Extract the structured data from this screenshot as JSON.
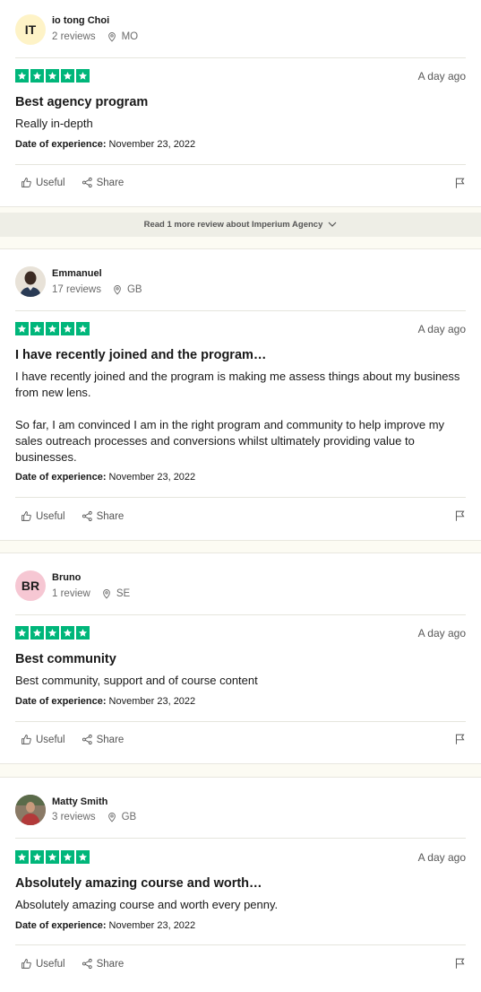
{
  "actions": {
    "useful": "Useful",
    "share": "Share"
  },
  "date_label": "Date of experience:",
  "read_more": "Read 1 more review about Imperium Agency",
  "colors": {
    "star_green": "#00b67a"
  },
  "reviews": [
    {
      "initials": "IT",
      "avatar_color": "#fef3c7",
      "name": "io tong Choi",
      "review_count": "2 reviews",
      "country": "MO",
      "rating": 5,
      "posted": "A day ago",
      "title": "Best agency program",
      "body": "Really in-depth",
      "date_of_experience": "November 23, 2022"
    },
    {
      "initials": "",
      "avatar_color": "#3a3a3a",
      "name": "Emmanuel",
      "review_count": "17 reviews",
      "country": "GB",
      "rating": 5,
      "posted": "A day ago",
      "title": "I have recently joined and the program…",
      "body_p1": "I have recently joined and the program is making me assess things about my business from new lens.",
      "body_p2": "So far, I am convinced I am in the right program and community to help improve my sales outreach processes and conversions whilst ultimately providing value to businesses.",
      "date_of_experience": "November 23, 2022"
    },
    {
      "initials": "BR",
      "avatar_color": "#f6c7d3",
      "name": "Bruno",
      "review_count": "1 review",
      "country": "SE",
      "rating": 5,
      "posted": "A day ago",
      "title": "Best community",
      "body": "Best community, support and of course content",
      "date_of_experience": "November 23, 2022"
    },
    {
      "initials": "",
      "avatar_color": "#6b4f3a",
      "name": "Matty Smith",
      "review_count": "3 reviews",
      "country": "GB",
      "rating": 5,
      "posted": "A day ago",
      "title": "Absolutely amazing course and worth…",
      "body": "Absolutely amazing course and worth every penny.",
      "date_of_experience": "November 23, 2022"
    }
  ]
}
